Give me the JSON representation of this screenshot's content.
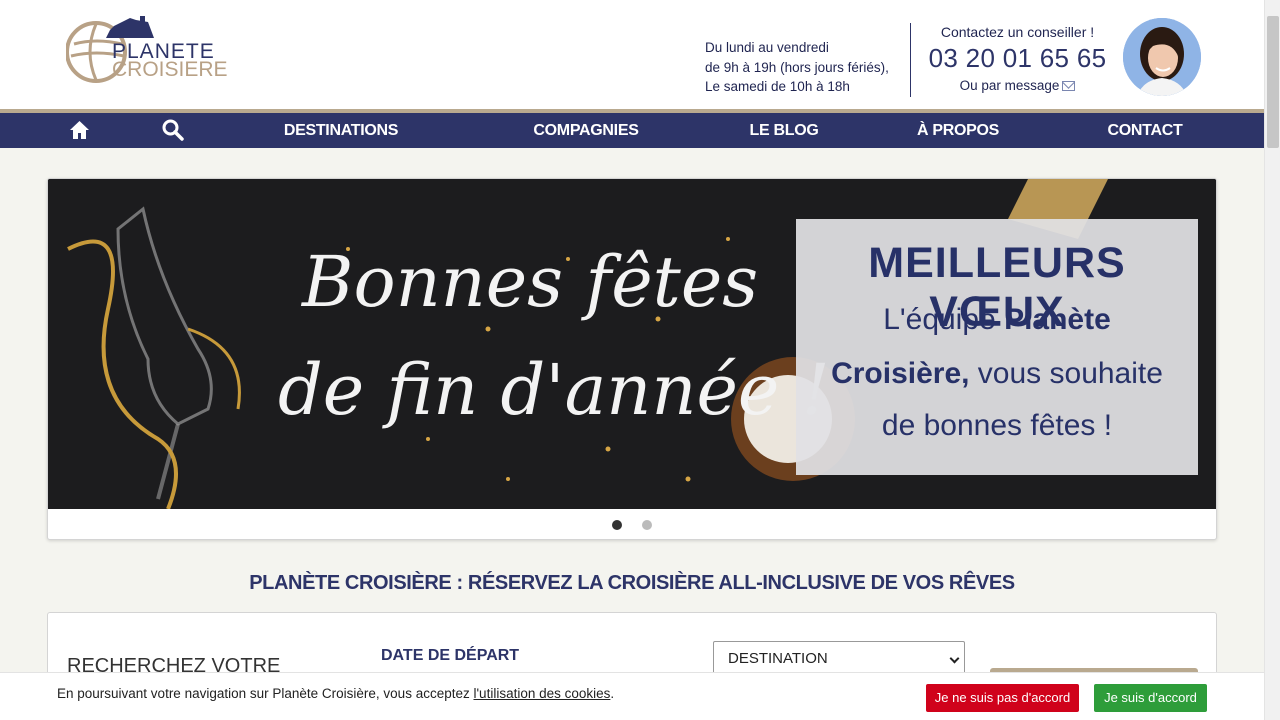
{
  "header": {
    "logo_line1": "PLANETE",
    "logo_line2": "CROISIERE",
    "hours": {
      "line1": "Du lundi au vendredi",
      "line2": "de 9h à 19h (hors jours fériés),",
      "line3": "Le samedi de 10h à 18h"
    },
    "contact": {
      "title": "Contactez un conseiller !",
      "phone": "03 20 01 65 65",
      "message": "Ou par message"
    }
  },
  "nav": {
    "items": [
      "DESTINATIONS",
      "COMPAGNIES",
      "LE BLOG",
      "À PROPOS",
      "CONTACT"
    ]
  },
  "carousel": {
    "script_line1": "Bonnes fêtes",
    "script_line2": "de fin d'année !",
    "box_title": "MEILLEURS VŒUX",
    "box_line1_a": "L'équipe ",
    "box_line1_b": "Planète",
    "box_line2_a": "Croisière,",
    "box_line2_b": " vous souhaite",
    "box_line3": "de bonnes fêtes !",
    "slide_count": 2,
    "active_slide": 1
  },
  "headline": "PLANÈTE CROISIÈRE : RÉSERVEZ LA CROISIÈRE ALL-INCLUSIVE DE VOS RÊVES",
  "search": {
    "title": "RECHERCHEZ VOTRE",
    "date_label": "DATE DE DÉPART",
    "destination_value": "DESTINATION"
  },
  "cookie": {
    "text_before": "En poursuivant votre navigation sur Planète Croisière, vous acceptez ",
    "link": "l'utilisation des cookies",
    "text_after": ".",
    "refuse": "Je ne suis pas d'accord",
    "accept": "Je suis d'accord"
  },
  "colors": {
    "navy": "#2d3468",
    "gold": "#b9a98f",
    "refuse": "#d0021b",
    "accept": "#2e9d3a"
  }
}
